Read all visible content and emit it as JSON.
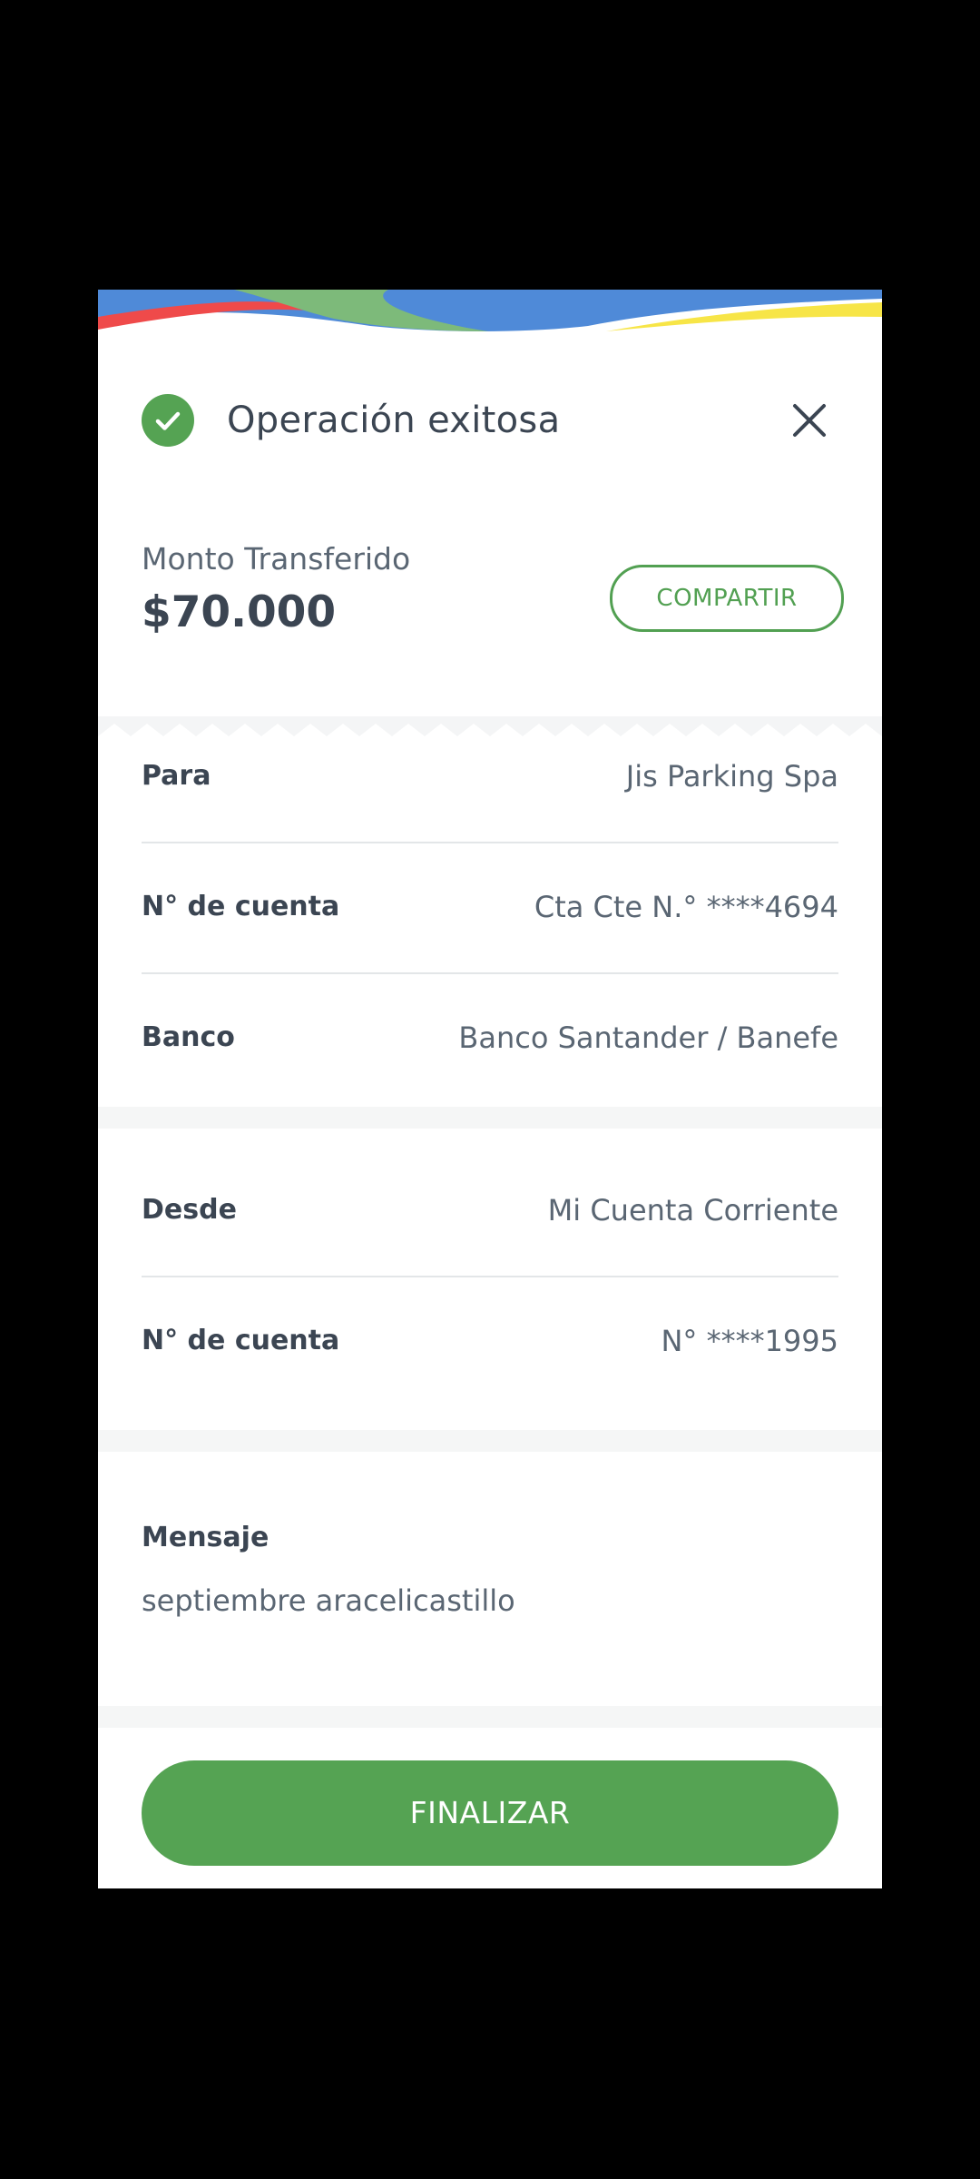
{
  "header": {
    "title": "Operación exitosa",
    "success_icon": "check-circle-icon",
    "close_icon": "close-icon"
  },
  "amount": {
    "label": "Monto Transferido",
    "value": "$70.000"
  },
  "share_button": {
    "label": "COMPARTIR"
  },
  "recipient": {
    "rows": [
      {
        "label": "Para",
        "value": "Jis Parking Spa"
      },
      {
        "label": "N° de cuenta",
        "value": "Cta Cte N.° ****4694"
      },
      {
        "label": "Banco",
        "value": "Banco Santander / Banefe"
      }
    ]
  },
  "origin": {
    "rows": [
      {
        "label": "Desde",
        "value": "Mi Cuenta Corriente"
      },
      {
        "label": "N° de cuenta",
        "value": "N° ****1995"
      }
    ]
  },
  "message": {
    "label": "Mensaje",
    "text": "septiembre aracelicastillo"
  },
  "finish_button": {
    "label": "FINALIZAR"
  },
  "colors": {
    "accent_green": "#55a353",
    "text_dark": "#3b4552",
    "text_muted": "#5a6673",
    "wave_blue": "#4f8ad8",
    "wave_red": "#ef4a4a",
    "wave_green": "#7dba7a",
    "wave_yellow": "#f7e547"
  }
}
